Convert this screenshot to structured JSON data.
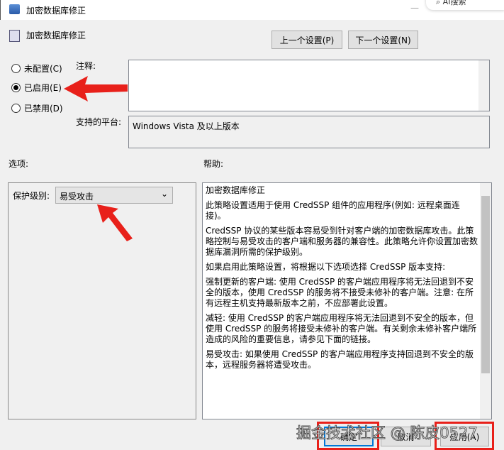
{
  "window": {
    "title": "加密数据库修正",
    "search_overlay": "AI搜索"
  },
  "header": {
    "policy_title": "加密数据库修正",
    "prev_button": "上一个设置(P)",
    "next_button": "下一个设置(N)"
  },
  "state": {
    "options": [
      {
        "label": "未配置(C)",
        "checked": false
      },
      {
        "label": "已启用(E)",
        "checked": true
      },
      {
        "label": "已禁用(D)",
        "checked": false
      }
    ]
  },
  "comment": {
    "label": "注释:",
    "value": ""
  },
  "platform": {
    "label": "支持的平台:",
    "value": "Windows Vista 及以上版本"
  },
  "options_panel": {
    "label": "选项:",
    "protection_label": "保护级别:",
    "protection_value": "易受攻击"
  },
  "help_panel": {
    "label": "帮助:",
    "paragraphs": [
      "加密数据库修正",
      "此策略设置适用于使用 CredSSP 组件的应用程序(例如: 远程桌面连接)。",
      "CredSSP 协议的某些版本容易受到针对客户端的加密数据库攻击。此策略控制与易受攻击的客户端和服务器的兼容性。此策略允许你设置加密数据库漏洞所需的保护级别。",
      "如果启用此策略设置，将根据以下选项选择 CredSSP 版本支持:",
      "强制更新的客户端: 使用 CredSSP 的客户端应用程序将无法回退到不安全的版本，使用 CredSSP 的服务将不接受未修补的客户端。注意: 在所有远程主机支持最新版本之前，不应部署此设置。",
      "减轻: 使用 CredSSP 的客户端应用程序将无法回退到不安全的版本，但使用 CredSSP 的服务将接受未修补的客户端。有关剩余未修补客户端所造成的风险的重要信息，请参见下面的链接。",
      "易受攻击: 如果使用 CredSSP 的客户端应用程序支持回退到不安全的版本，远程服务器将遭受攻击。"
    ]
  },
  "footer": {
    "ok": "确定",
    "cancel": "取消",
    "apply": "应用(A)"
  },
  "watermark": "掘金技术社区 @ 陈皮0527",
  "colors": {
    "annotation_red": "#e8201a"
  }
}
